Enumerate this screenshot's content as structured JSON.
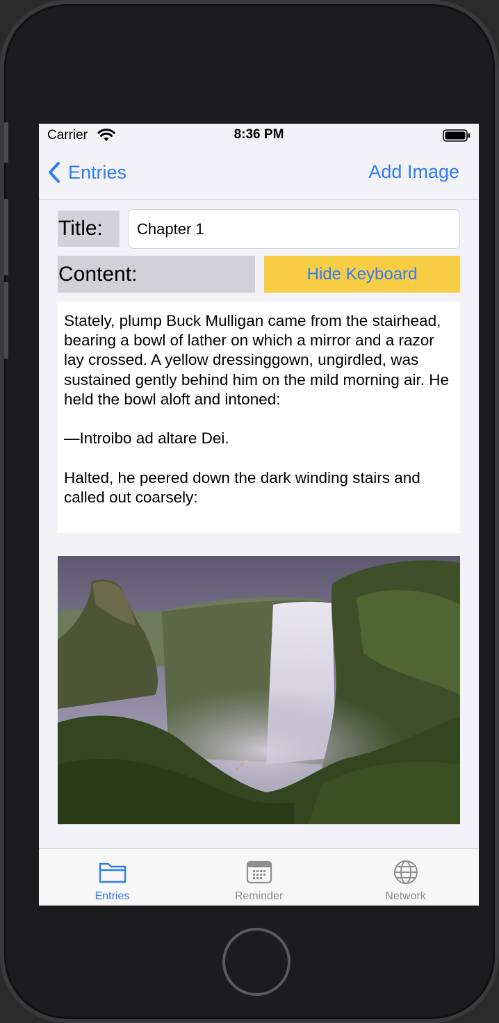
{
  "status_bar": {
    "carrier": "Carrier",
    "time": "8:36 PM"
  },
  "nav": {
    "back_label": "Entries",
    "add_image_label": "Add Image"
  },
  "form": {
    "title_label": "Title:",
    "title_value": "Chapter 1",
    "content_label": "Content:",
    "hide_keyboard_label": "Hide Keyboard",
    "content_text": "Stately, plump Buck Mulligan came from the stairhead, bearing a bowl of lather on which a mirror and a razor lay crossed. A yellow dressinggown, ungirdled, was sustained gently behind him on the mild morning air. He held the bowl aloft and intoned:\n\n—Introibo ad altare Dei.\n\nHalted, he peered down the dark winding stairs and called out coarsely:"
  },
  "tabs": [
    {
      "label": "Entries",
      "icon": "folder-icon",
      "active": true
    },
    {
      "label": "Reminder",
      "icon": "calendar-icon",
      "active": false
    },
    {
      "label": "Network",
      "icon": "globe-icon",
      "active": false
    }
  ],
  "colors": {
    "accent": "#2f7cf6",
    "button_yellow": "#f8cd46",
    "label_gray": "#d1d1d6",
    "inactive_tab": "#8e8e93"
  }
}
